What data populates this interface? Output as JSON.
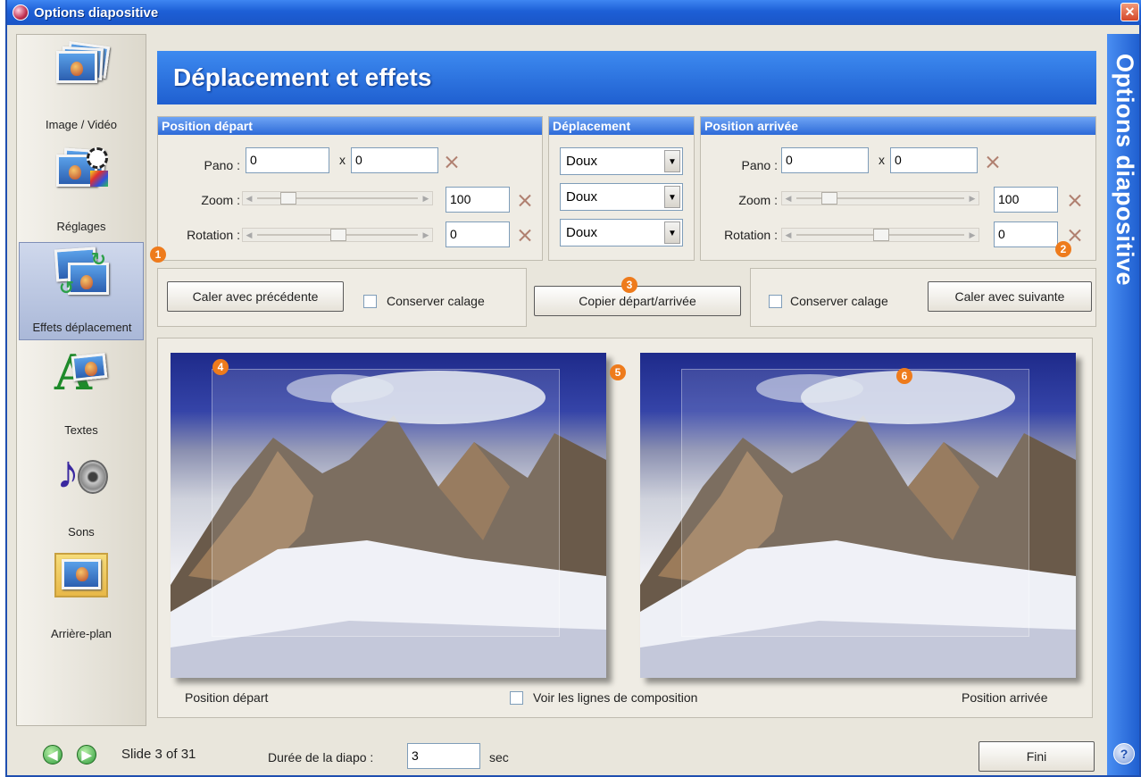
{
  "window": {
    "title": "Options diapositive",
    "close_glyph": "✕"
  },
  "sidebar": {
    "items": [
      {
        "label": "Image / Vidéo",
        "icon": "image-video-icon"
      },
      {
        "label": "Réglages",
        "icon": "settings-icon"
      },
      {
        "label": "Effets déplacement",
        "icon": "motion-effects-icon",
        "active": true
      },
      {
        "label": "Textes",
        "icon": "text-icon"
      },
      {
        "label": "Sons",
        "icon": "sound-icon"
      },
      {
        "label": "Arrière-plan",
        "icon": "background-icon"
      }
    ]
  },
  "header": {
    "title": "Déplacement et effets"
  },
  "vertical_title": "Options diapositive",
  "help_glyph": "?",
  "start_position": {
    "title": "Position départ",
    "pano_label": "Pano :",
    "pano_x": "0",
    "pano_sep": "x",
    "pano_y": "0",
    "zoom_label": "Zoom :",
    "zoom_value": "100",
    "rotation_label": "Rotation :",
    "rotation_value": "0"
  },
  "movement": {
    "title": "Déplacement",
    "options": [
      "Doux",
      "Doux",
      "Doux"
    ]
  },
  "end_position": {
    "title": "Position arrivée",
    "pano_label": "Pano :",
    "pano_x": "0",
    "pano_sep": "x",
    "pano_y": "0",
    "zoom_label": "Zoom :",
    "zoom_value": "100",
    "rotation_label": "Rotation :",
    "rotation_value": "0"
  },
  "buttons": {
    "align_previous": "Caler avec précédente",
    "keep_alignment_left": "Conserver calage",
    "copy_start_end": "Copier départ/arrivée",
    "keep_alignment_right": "Conserver calage",
    "align_next": "Caler avec suivante",
    "done": "Fini"
  },
  "preview": {
    "start_label": "Position départ",
    "end_label": "Position arrivée",
    "composition_lines": "Voir les lignes de composition"
  },
  "footer": {
    "slide_info": "Slide 3 of 31",
    "duration_label": "Durée de la diapo :",
    "duration_value": "3",
    "duration_unit": "sec"
  },
  "badges": [
    "1",
    "2",
    "3",
    "4",
    "5",
    "6"
  ],
  "colors": {
    "accent": "#1f5fd0",
    "badge": "#ee7b1c",
    "panel": "#efece4"
  }
}
